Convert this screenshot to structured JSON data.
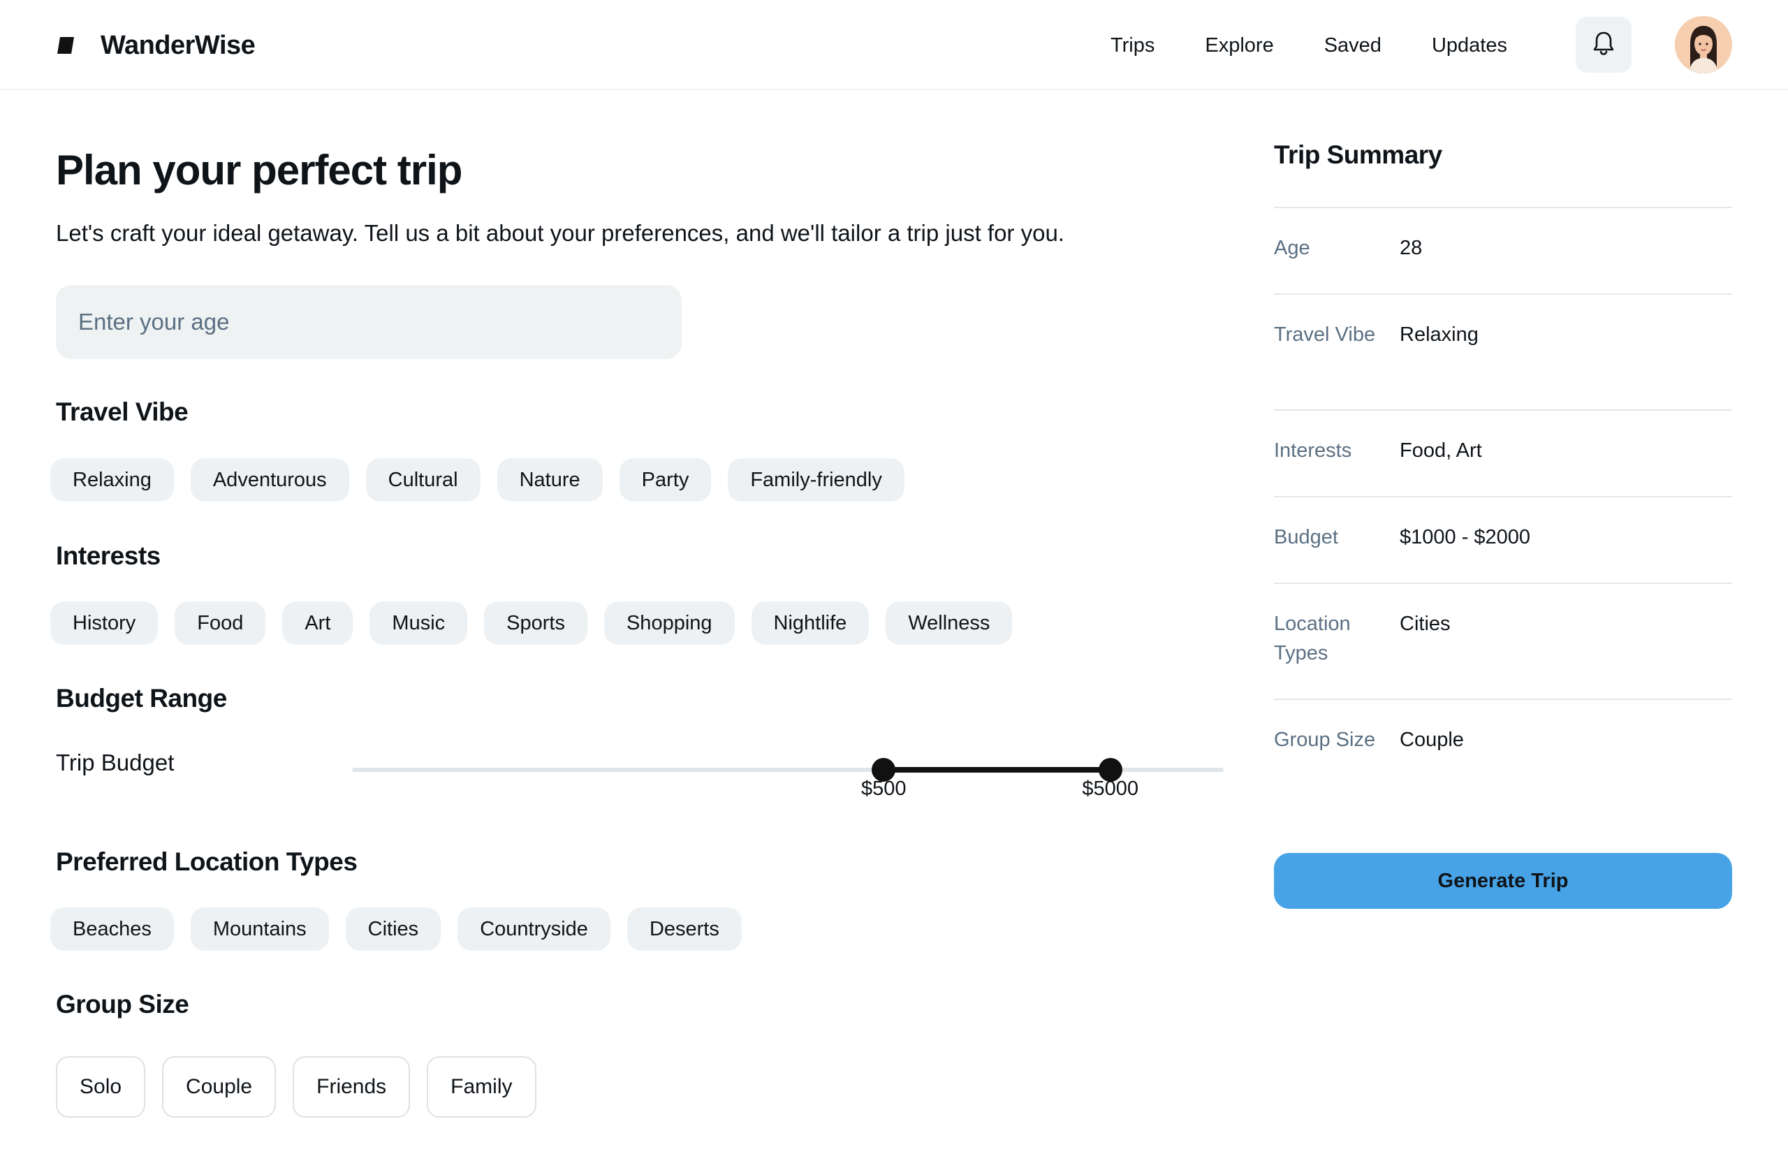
{
  "app": {
    "name": "WanderWise"
  },
  "nav": [
    {
      "label": "Trips"
    },
    {
      "label": "Explore"
    },
    {
      "label": "Saved"
    },
    {
      "label": "Updates"
    }
  ],
  "main": {
    "title": "Plan your perfect trip",
    "subtitle": "Let's craft your ideal getaway. Tell us a bit about your preferences, and we'll tailor a trip just for you.",
    "age_input": {
      "placeholder": "Enter your age",
      "value": ""
    },
    "travel_vibe": {
      "title": "Travel Vibe",
      "options": [
        "Relaxing",
        "Adventurous",
        "Cultural",
        "Nature",
        "Party",
        "Family-friendly"
      ]
    },
    "interests": {
      "title": "Interests",
      "options": [
        "History",
        "Food",
        "Art",
        "Music",
        "Sports",
        "Shopping",
        "Nightlife",
        "Wellness"
      ]
    },
    "budget": {
      "title": "Budget Range",
      "label": "Trip Budget",
      "min_value": 500,
      "max_value": 5000,
      "min_label": "$500",
      "max_label": "$5000",
      "low_fraction": 0.61,
      "high_fraction": 0.87
    },
    "location_types": {
      "title": "Preferred Location Types",
      "options": [
        "Beaches",
        "Mountains",
        "Cities",
        "Countryside",
        "Deserts"
      ]
    },
    "group_size": {
      "title": "Group Size",
      "options": [
        "Solo",
        "Couple",
        "Friends",
        "Family"
      ]
    }
  },
  "summary": {
    "title": "Trip Summary",
    "rows": [
      {
        "key": "Age",
        "value": "28"
      },
      {
        "key": "Travel Vibe",
        "value": "Relaxing"
      },
      {
        "key": "Interests",
        "value": "Food, Art"
      },
      {
        "key": "Budget",
        "value": "$1000 - $2000"
      },
      {
        "key": "Location Types",
        "value": "Cities"
      },
      {
        "key": "Group Size",
        "value": "Couple"
      }
    ],
    "generate_label": "Generate Trip"
  },
  "colors": {
    "accent": "#47a3e6",
    "chip_bg": "#eef1f3",
    "muted_text": "#5b7083",
    "avatar_bg": "#f6cfb1"
  },
  "icons": {
    "logo": "brand-logo-icon",
    "notifications": "bell-icon",
    "profile": "avatar"
  }
}
